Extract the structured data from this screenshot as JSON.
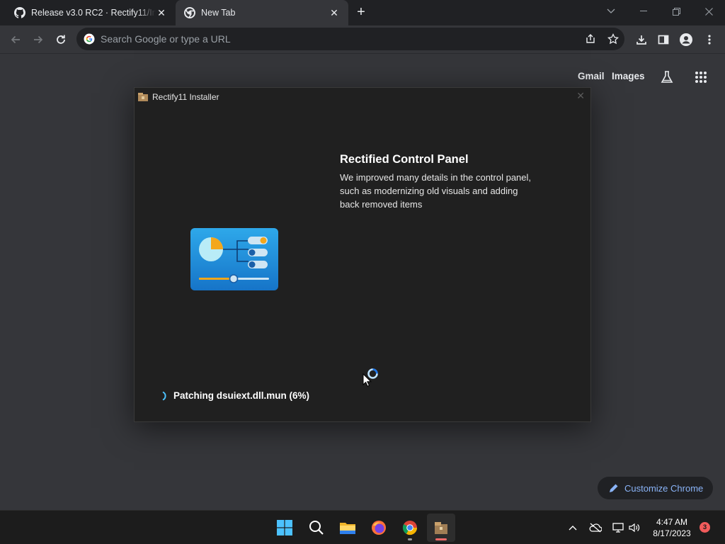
{
  "browser": {
    "tabs": [
      {
        "title": "Release v3.0 RC2 · Rectify11/Installer",
        "favicon": "github-icon",
        "active": false
      },
      {
        "title": "New Tab",
        "favicon": "chrome-icon",
        "active": true
      }
    ],
    "omnibox_placeholder": "Search Google or type a URL"
  },
  "ntp": {
    "links": [
      "Gmail",
      "Images"
    ],
    "customize_label": "Customize Chrome"
  },
  "installer": {
    "window_title": "Rectify11 Installer",
    "feature_title": "Rectified Control Panel",
    "feature_description": "We improved many details in the control panel, such as modernizing old visuals and adding back removed items",
    "progress_text": "Patching dsuiext.dll.mun (6%)",
    "progress_percent": 6
  },
  "taskbar": {
    "time": "4:47 AM",
    "date": "8/17/2023",
    "notification_count": "3",
    "apps": [
      "start",
      "search",
      "file-explorer",
      "firefox",
      "chrome",
      "installer"
    ]
  },
  "colors": {
    "accent_blue": "#8ab4f8",
    "dialog_bg": "#202020",
    "browser_bg": "#35363a"
  }
}
